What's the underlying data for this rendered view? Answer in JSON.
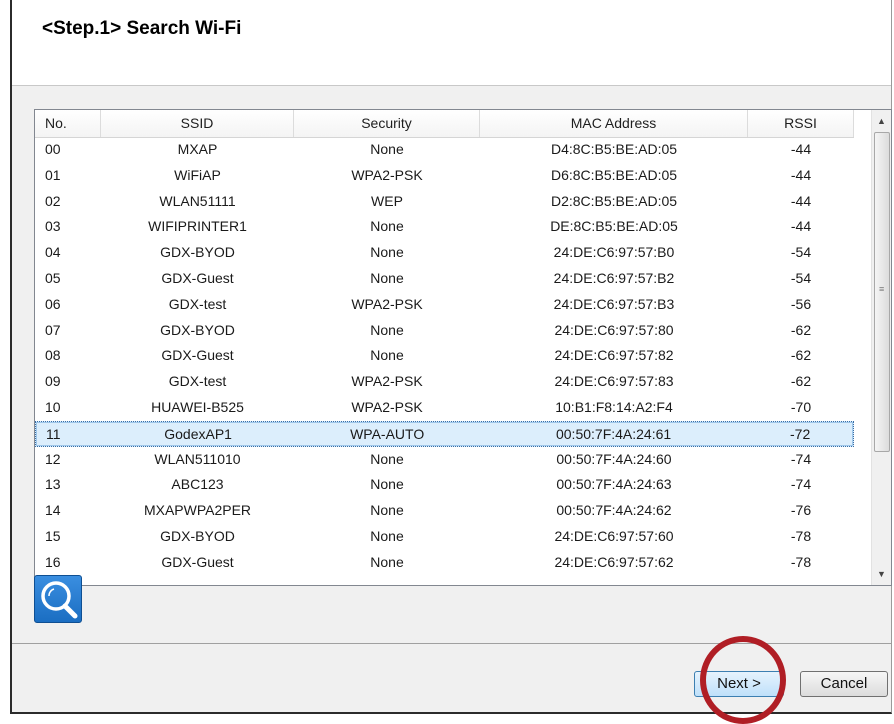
{
  "header": {
    "title": "<Step.1> Search Wi-Fi"
  },
  "table": {
    "columns": [
      "No.",
      "SSID",
      "Security",
      "MAC Address",
      "RSSI"
    ],
    "selected_index": 11,
    "rows": [
      {
        "no": "00",
        "ssid": "MXAP",
        "security": "None",
        "mac": "D4:8C:B5:BE:AD:05",
        "rssi": "-44"
      },
      {
        "no": "01",
        "ssid": "WiFiAP",
        "security": "WPA2-PSK",
        "mac": "D6:8C:B5:BE:AD:05",
        "rssi": "-44"
      },
      {
        "no": "02",
        "ssid": "WLAN51111",
        "security": "WEP",
        "mac": "D2:8C:B5:BE:AD:05",
        "rssi": "-44"
      },
      {
        "no": "03",
        "ssid": "WIFIPRINTER1",
        "security": "None",
        "mac": "DE:8C:B5:BE:AD:05",
        "rssi": "-44"
      },
      {
        "no": "04",
        "ssid": "GDX-BYOD",
        "security": "None",
        "mac": "24:DE:C6:97:57:B0",
        "rssi": "-54"
      },
      {
        "no": "05",
        "ssid": "GDX-Guest",
        "security": "None",
        "mac": "24:DE:C6:97:57:B2",
        "rssi": "-54"
      },
      {
        "no": "06",
        "ssid": "GDX-test",
        "security": "WPA2-PSK",
        "mac": "24:DE:C6:97:57:B3",
        "rssi": "-56"
      },
      {
        "no": "07",
        "ssid": "GDX-BYOD",
        "security": "None",
        "mac": "24:DE:C6:97:57:80",
        "rssi": "-62"
      },
      {
        "no": "08",
        "ssid": "GDX-Guest",
        "security": "None",
        "mac": "24:DE:C6:97:57:82",
        "rssi": "-62"
      },
      {
        "no": "09",
        "ssid": "GDX-test",
        "security": "WPA2-PSK",
        "mac": "24:DE:C6:97:57:83",
        "rssi": "-62"
      },
      {
        "no": "10",
        "ssid": "HUAWEI-B525",
        "security": "WPA2-PSK",
        "mac": "10:B1:F8:14:A2:F4",
        "rssi": "-70"
      },
      {
        "no": "11",
        "ssid": "GodexAP1",
        "security": "WPA-AUTO",
        "mac": "00:50:7F:4A:24:61",
        "rssi": "-72"
      },
      {
        "no": "12",
        "ssid": "WLAN511010",
        "security": "None",
        "mac": "00:50:7F:4A:24:60",
        "rssi": "-74"
      },
      {
        "no": "13",
        "ssid": "ABC123",
        "security": "None",
        "mac": "00:50:7F:4A:24:63",
        "rssi": "-74"
      },
      {
        "no": "14",
        "ssid": "MXAPWPA2PER",
        "security": "None",
        "mac": "00:50:7F:4A:24:62",
        "rssi": "-76"
      },
      {
        "no": "15",
        "ssid": "GDX-BYOD",
        "security": "None",
        "mac": "24:DE:C6:97:57:60",
        "rssi": "-78"
      },
      {
        "no": "16",
        "ssid": "GDX-Guest",
        "security": "None",
        "mac": "24:DE:C6:97:57:62",
        "rssi": "-78"
      }
    ]
  },
  "buttons": {
    "next_label": "Next >",
    "cancel_label": "Cancel"
  },
  "icons": {
    "search": "search-icon",
    "scroll_up": "scroll-up-arrow-icon",
    "scroll_down": "scroll-down-arrow-icon"
  },
  "colors": {
    "accent": "#1b6ec2",
    "selection": "#dceefc",
    "highlight_circle": "#b01e25"
  }
}
